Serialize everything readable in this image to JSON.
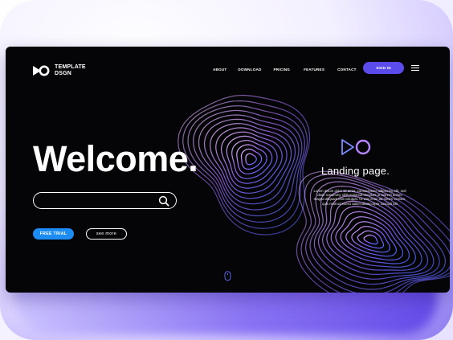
{
  "brand": {
    "logo_line1": "TEMPLATE",
    "logo_line2": "DSGN",
    "icon": "play-circle-logo-icon"
  },
  "nav": {
    "items": [
      {
        "label": "ABOUT"
      },
      {
        "label": "DOWNLOAD"
      },
      {
        "label": "PRICING"
      },
      {
        "label": "FEATURES"
      },
      {
        "label": "CONTACT"
      }
    ],
    "signin_label": "SIGN IN",
    "menu_icon": "hamburger-menu-icon"
  },
  "hero": {
    "headline": "Welcome.",
    "search": {
      "value": "",
      "placeholder": "",
      "icon": "search-icon"
    },
    "free_trial_label": "FREE TRIAL",
    "see_more_label": "see more"
  },
  "side": {
    "logo_icon": "play-circle-logo-icon",
    "title": "Landing page.",
    "paragraph": "Lorem ipsum dolor sit amet, consectetuer adipiscing elit, sed diam nonummy nibh euismod tincidunt ut laoreet dolore magna aliquam erat volutpat. Ut wisi enim ad minim veniam, quis nostrud exerci tation ullamcorper suscipit lob"
  },
  "scroll_icon": "mouse-scroll-icon",
  "colors": {
    "background": "#050507",
    "accent_purple": "#5a4bea",
    "accent_blue": "#1d8cf2",
    "swirl_start": "#c87cff",
    "swirl_end": "#4e58ff"
  }
}
